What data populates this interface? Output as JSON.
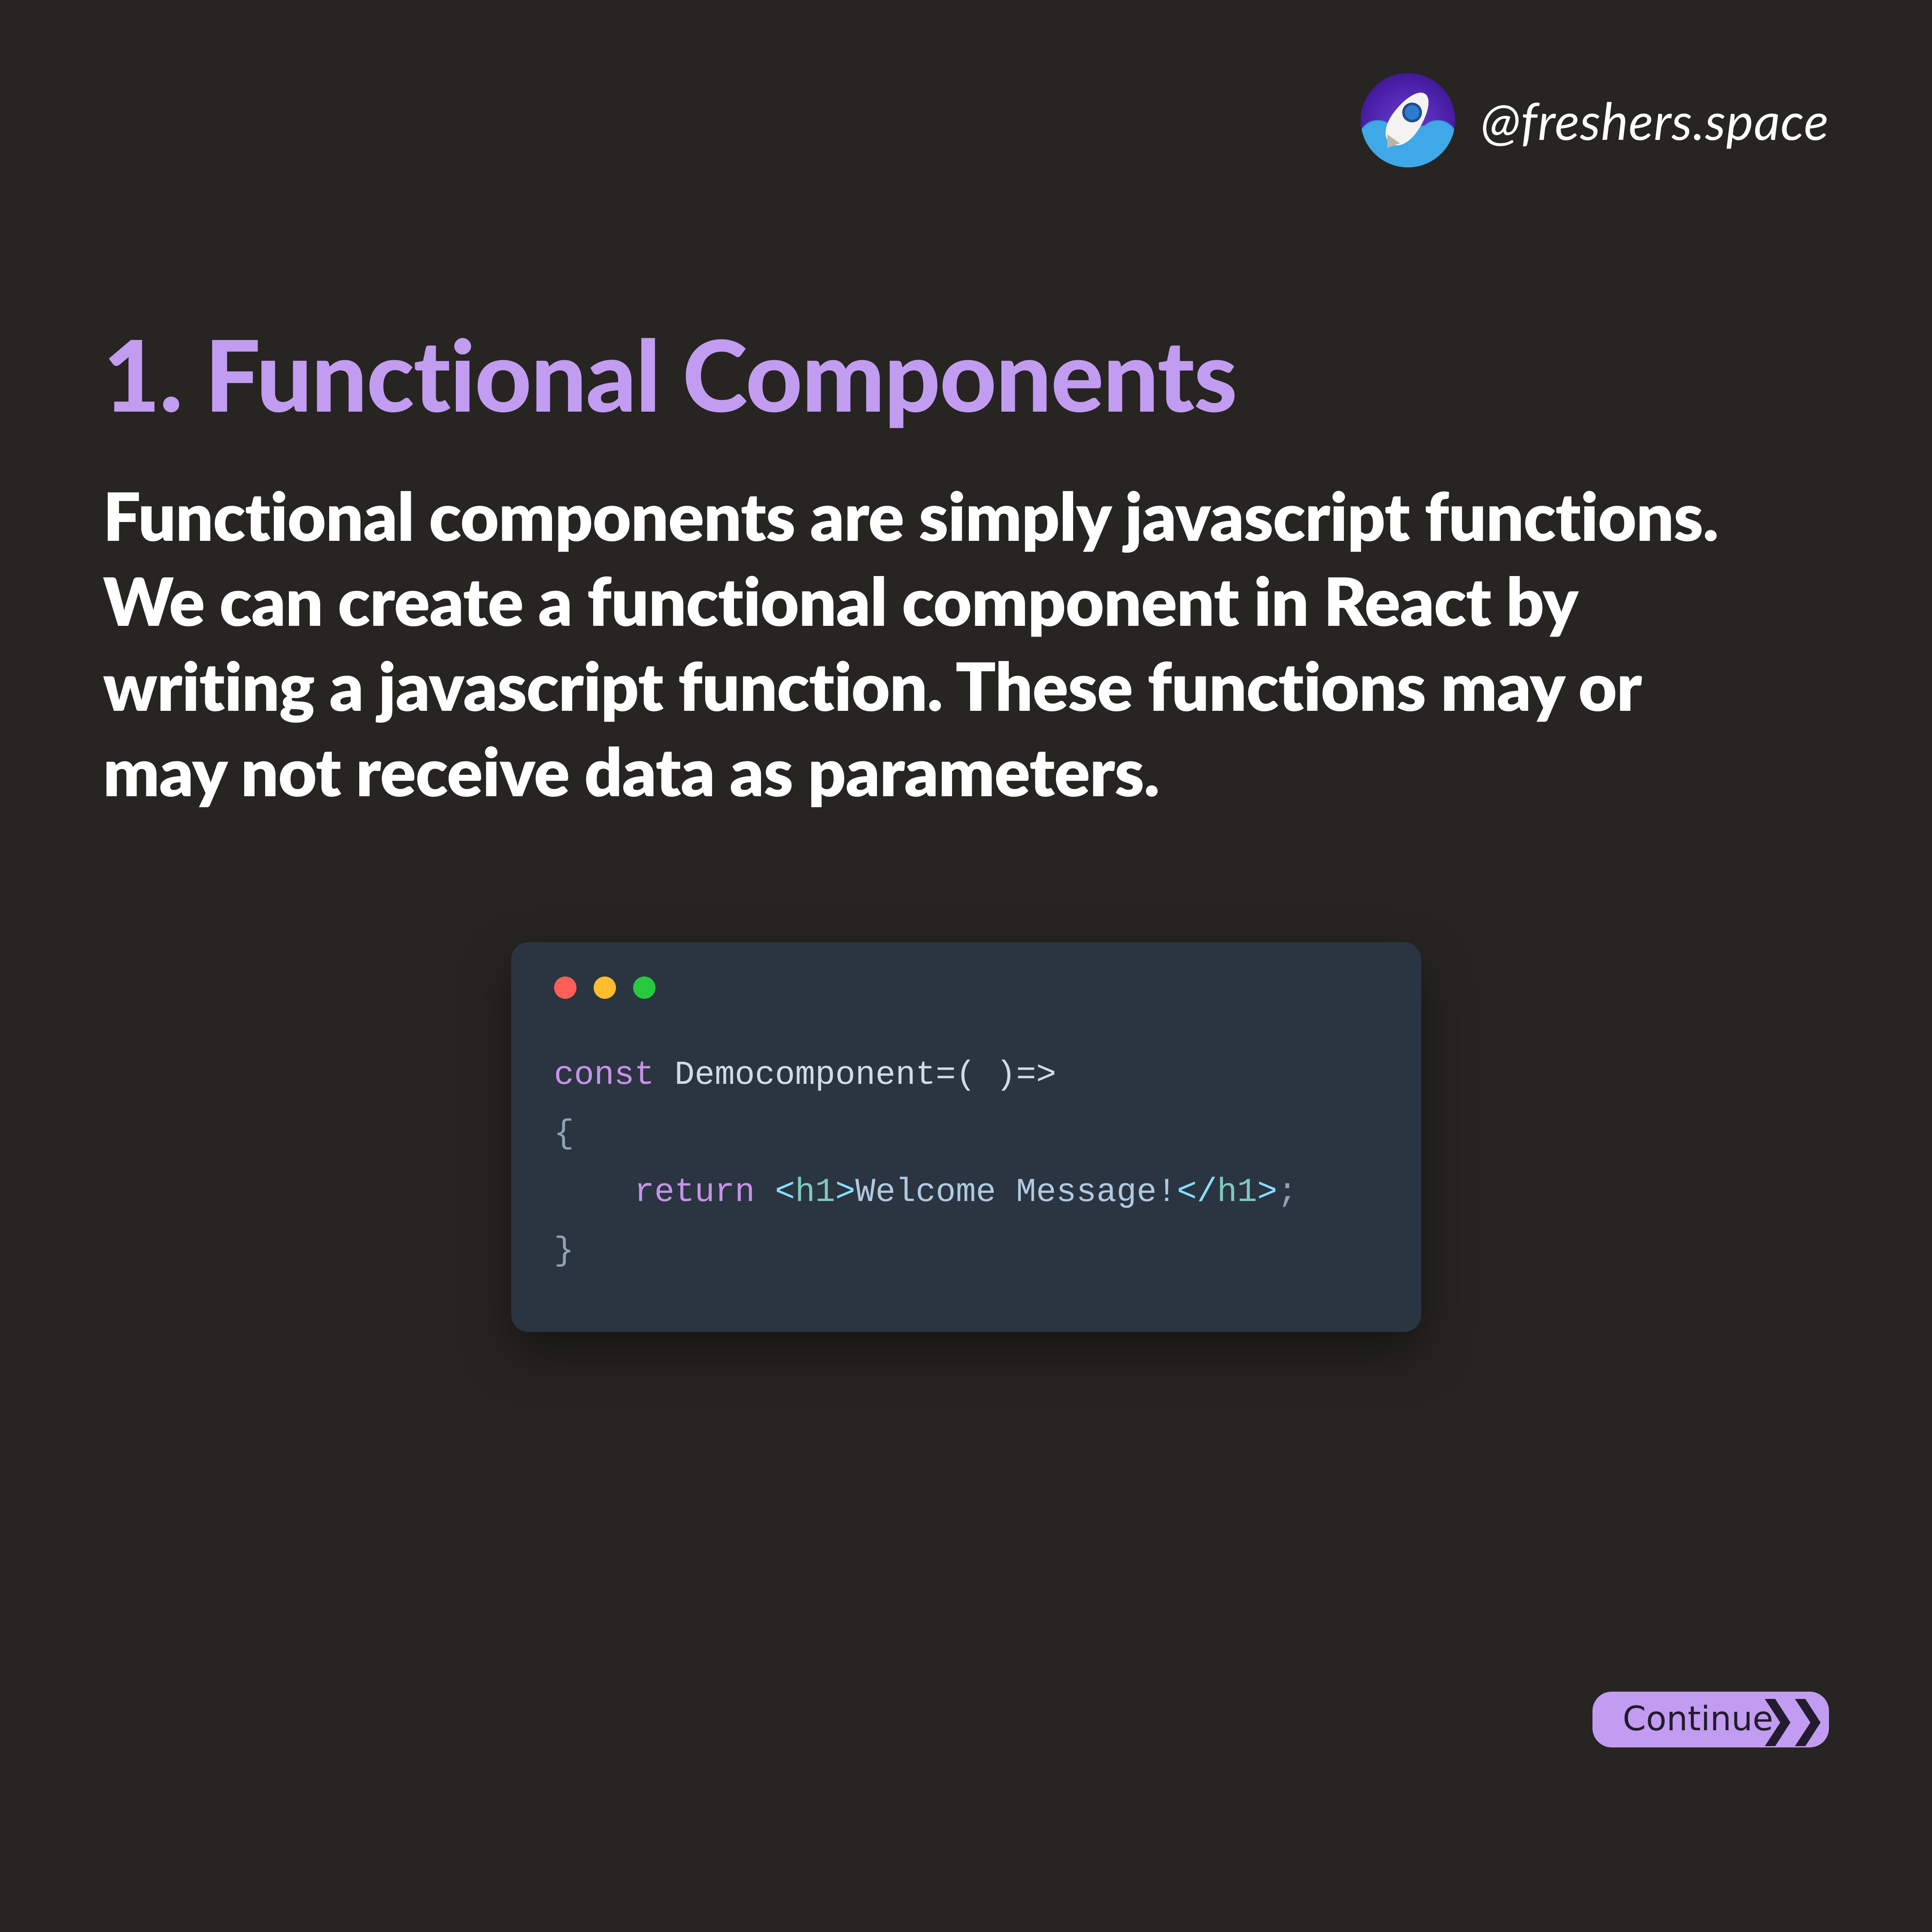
{
  "header": {
    "handle": "@freshers.space"
  },
  "heading": "1. Functional Components",
  "paragraph": "Functional components are simply javascript functions.\nWe can create a functional component in React by writing a javascript function. These functions may or may not receive data as parameters.",
  "code": {
    "line1_kw": "const",
    "line1_rest": " Democomponent=( )=>",
    "line2": "{",
    "line3_indent": "    ",
    "line3_return": "return",
    "line3_space": " ",
    "line3_open_ang": "<",
    "line3_tag1": "h1",
    "line3_close_ang1": ">",
    "line3_text": "Welcome Message!",
    "line3_open_ang2": "</",
    "line3_tag2": "h1",
    "line3_close_ang2": ">",
    "line3_semi": ";",
    "line4": "}"
  },
  "button": {
    "label": "Continue"
  }
}
